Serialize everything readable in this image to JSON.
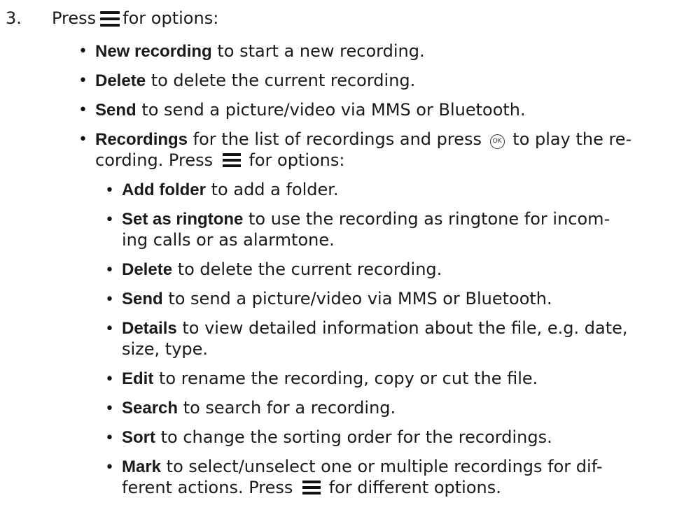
{
  "step": {
    "number": "3.",
    "text_before": "Press",
    "icon": "menu-icon",
    "text_after": "for options:"
  },
  "items": [
    {
      "term": "New recording",
      "desc": "to start a new recording."
    },
    {
      "term": "Delete",
      "desc": "to delete the current recording."
    },
    {
      "term": "Send",
      "desc": "to send a picture/video via MMS or Bluetooth."
    },
    {
      "term": "Recordings",
      "desc_a": "for the list of recordings and press",
      "ok_icon": "OK",
      "desc_b": "to play the re-",
      "desc_line2_a": "cording. Press",
      "desc_line2_b": "for options:"
    }
  ],
  "subitems": [
    {
      "term": "Add folder",
      "desc": "to add a folder."
    },
    {
      "term": "Set as ringtone",
      "desc": "to use the recording as ringtone for incom-",
      "desc2": "ing calls or as alarmtone."
    },
    {
      "term": "Delete",
      "desc": "to delete the current recording."
    },
    {
      "term": "Send",
      "desc": "to send a picture/video via MMS or Bluetooth."
    },
    {
      "term": "Details",
      "desc": "to view detailed information about the file, e.g. date,",
      "desc2": "size, type."
    },
    {
      "term": "Edit",
      "desc": "to rename the recording, copy or cut the file."
    },
    {
      "term": "Search",
      "desc": "to search for a recording."
    },
    {
      "term": "Sort",
      "desc": "to change the sorting order for the recordings."
    },
    {
      "term": "Mark",
      "desc": "to select/unselect one or multiple recordings for dif-",
      "desc2_a": "ferent actions. Press",
      "desc2_b": "for different options."
    }
  ],
  "bullet": "•"
}
